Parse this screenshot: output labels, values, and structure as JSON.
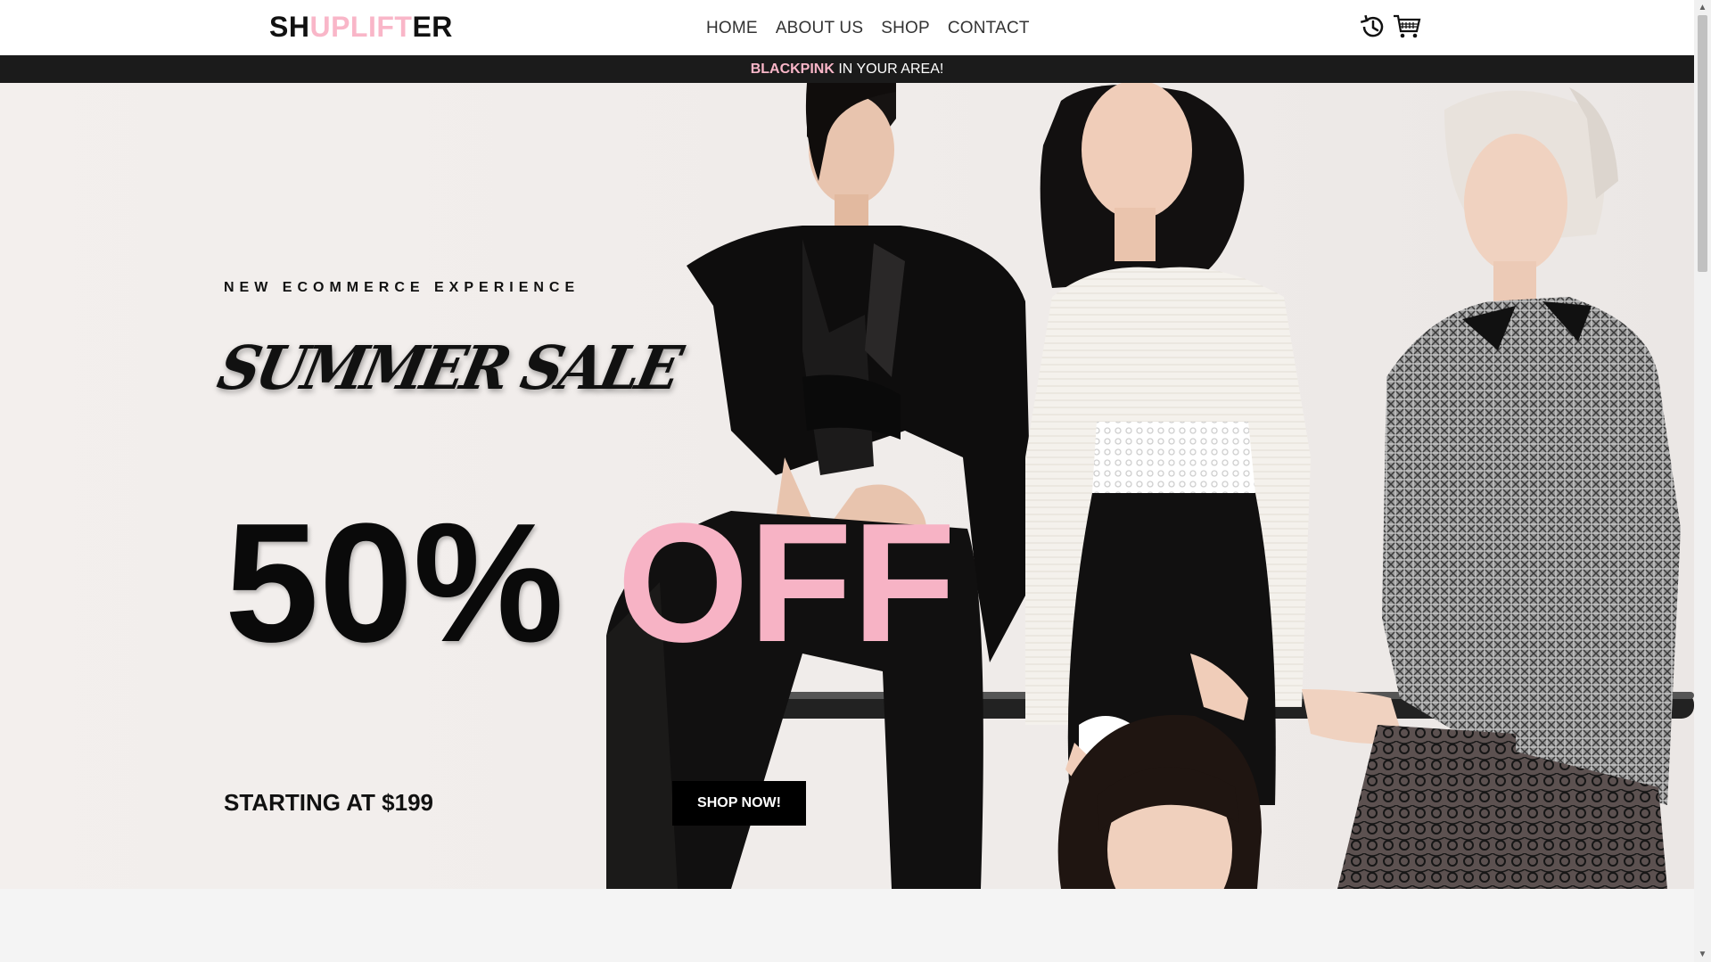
{
  "header": {
    "logo": {
      "part1": "SH",
      "part2": "UPLIFT",
      "part3": "ER"
    },
    "nav": [
      "HOME",
      "ABOUT US",
      "SHOP",
      "CONTACT"
    ],
    "icons": [
      "history-icon",
      "cart-icon"
    ]
  },
  "announcement": {
    "brand": "BLACKPINK",
    "text": " IN YOUR AREA!"
  },
  "hero": {
    "tagline": "NEW ECOMMERCE EXPERIENCE",
    "headline": "SUMMER SALE",
    "discount": "50%",
    "discount_suffix": "OFF",
    "starting": "STARTING AT $199",
    "button": "SHOP NOW!"
  },
  "colors": {
    "accent": "#f9b6c8",
    "dark": "#1b1b1b",
    "text": "#111111"
  }
}
